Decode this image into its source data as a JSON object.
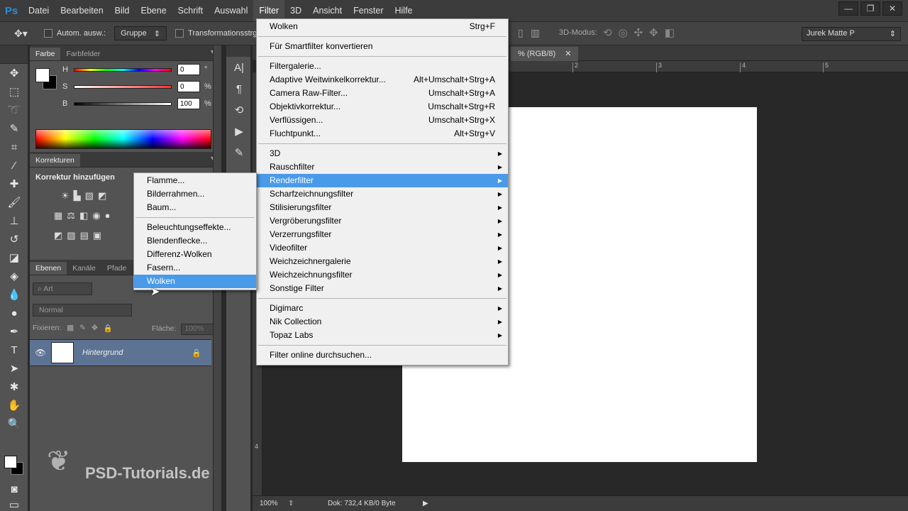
{
  "app": {
    "logo": "Ps"
  },
  "menubar": {
    "items": [
      "Datei",
      "Bearbeiten",
      "Bild",
      "Ebene",
      "Schrift",
      "Auswahl",
      "Filter",
      "3D",
      "Ansicht",
      "Fenster",
      "Hilfe"
    ],
    "active": "Filter"
  },
  "window_controls": {
    "minimize": "—",
    "restore": "❐",
    "close": "✕"
  },
  "options_bar": {
    "auto_select_label": "Autom. ausw.:",
    "auto_select_value": "Gruppe",
    "transform_label": "Transformationsstrg.",
    "mode_3d_label": "3D-Modus:",
    "workspace": "Jurek Matte P"
  },
  "color_panel": {
    "tabs": [
      "Farbe",
      "Farbfelder"
    ],
    "sliders": [
      {
        "label": "H",
        "value": "0",
        "unit": "°"
      },
      {
        "label": "S",
        "value": "0",
        "unit": "%"
      },
      {
        "label": "B",
        "value": "100",
        "unit": "%"
      }
    ]
  },
  "adjustments_panel": {
    "tab": "Korrekturen",
    "title": "Korrektur hinzufügen"
  },
  "layers_panel": {
    "tabs": [
      "Ebenen",
      "Kanäle",
      "Pfade"
    ],
    "filter_placeholder": "Art",
    "blend_mode": "Normal",
    "lock_label": "Fixieren:",
    "fill_label": "Fläche:",
    "fill_value": "100%",
    "layer_name": "Hintergrund"
  },
  "watermark": {
    "text": "PSD-Tutorials.de"
  },
  "document": {
    "tab_title": "% (RGB/8)",
    "ruler_h": [
      "2",
      "3",
      "4",
      "5"
    ],
    "ruler_v": [
      "4"
    ],
    "zoom": "100%",
    "doc_info": "Dok: 732,4 KB/0 Byte"
  },
  "filter_menu": {
    "items": [
      {
        "label": "Wolken",
        "shortcut": "Strg+F"
      },
      {
        "sep": true
      },
      {
        "label": "Für Smartfilter konvertieren",
        "shortcut": ""
      },
      {
        "sep": true
      },
      {
        "label": "Filtergalerie...",
        "shortcut": ""
      },
      {
        "label": "Adaptive Weitwinkelkorrektur...",
        "shortcut": "Alt+Umschalt+Strg+A"
      },
      {
        "label": "Camera Raw-Filter...",
        "shortcut": "Umschalt+Strg+A"
      },
      {
        "label": "Objektivkorrektur...",
        "shortcut": "Umschalt+Strg+R"
      },
      {
        "label": "Verflüssigen...",
        "shortcut": "Umschalt+Strg+X"
      },
      {
        "label": "Fluchtpunkt...",
        "shortcut": "Alt+Strg+V"
      },
      {
        "sep": true
      },
      {
        "label": "3D",
        "submenu": true
      },
      {
        "label": "Rauschfilter",
        "submenu": true
      },
      {
        "label": "Renderfilter",
        "submenu": true,
        "highlighted": true
      },
      {
        "label": "Scharfzeichnungsfilter",
        "submenu": true
      },
      {
        "label": "Stilisierungsfilter",
        "submenu": true
      },
      {
        "label": "Vergröberungsfilter",
        "submenu": true
      },
      {
        "label": "Verzerrungsfilter",
        "submenu": true
      },
      {
        "label": "Videofilter",
        "submenu": true
      },
      {
        "label": "Weichzeichnergalerie",
        "submenu": true
      },
      {
        "label": "Weichzeichnungsfilter",
        "submenu": true
      },
      {
        "label": "Sonstige Filter",
        "submenu": true
      },
      {
        "sep": true
      },
      {
        "label": "Digimarc",
        "submenu": true
      },
      {
        "label": "Nik Collection",
        "submenu": true
      },
      {
        "label": "Topaz Labs",
        "submenu": true
      },
      {
        "sep": true
      },
      {
        "label": "Filter online durchsuchen...",
        "shortcut": ""
      }
    ]
  },
  "render_submenu": {
    "items": [
      {
        "label": "Flamme..."
      },
      {
        "label": "Bilderrahmen..."
      },
      {
        "label": "Baum..."
      },
      {
        "sep": true
      },
      {
        "label": "Beleuchtungseffekte..."
      },
      {
        "label": "Blendenflecke..."
      },
      {
        "label": "Differenz-Wolken"
      },
      {
        "label": "Fasern..."
      },
      {
        "label": "Wolken",
        "highlighted": true
      }
    ]
  },
  "colors": {
    "menu_highlight": "#4a9aea",
    "layer_selected": "#5d7393",
    "ps_blue": "#2a8ed9"
  }
}
